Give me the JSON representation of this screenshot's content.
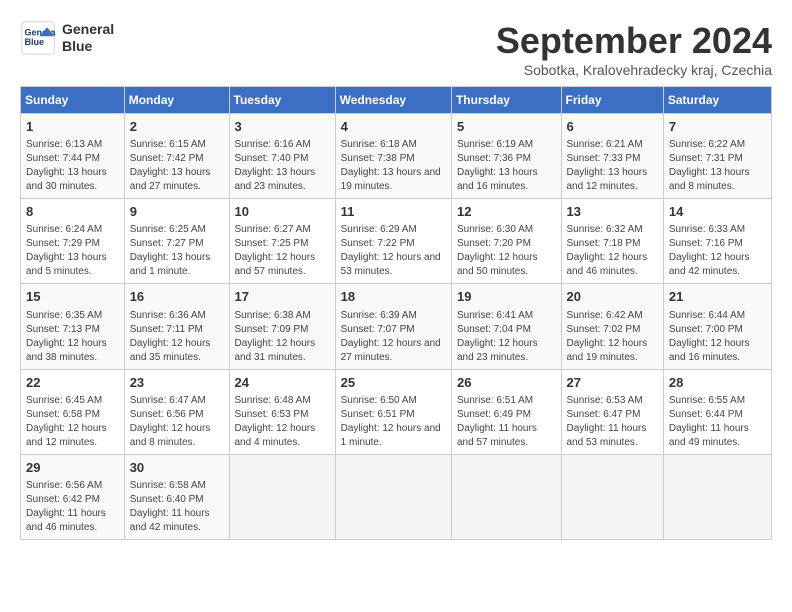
{
  "logo": {
    "line1": "General",
    "line2": "Blue"
  },
  "title": "September 2024",
  "subtitle": "Sobotka, Kralovehradecky kraj, Czechia",
  "days_of_week": [
    "Sunday",
    "Monday",
    "Tuesday",
    "Wednesday",
    "Thursday",
    "Friday",
    "Saturday"
  ],
  "weeks": [
    [
      {
        "day": "1",
        "sunrise": "6:13 AM",
        "sunset": "7:44 PM",
        "daylight": "13 hours and 30 minutes."
      },
      {
        "day": "2",
        "sunrise": "6:15 AM",
        "sunset": "7:42 PM",
        "daylight": "13 hours and 27 minutes."
      },
      {
        "day": "3",
        "sunrise": "6:16 AM",
        "sunset": "7:40 PM",
        "daylight": "13 hours and 23 minutes."
      },
      {
        "day": "4",
        "sunrise": "6:18 AM",
        "sunset": "7:38 PM",
        "daylight": "13 hours and 19 minutes."
      },
      {
        "day": "5",
        "sunrise": "6:19 AM",
        "sunset": "7:36 PM",
        "daylight": "13 hours and 16 minutes."
      },
      {
        "day": "6",
        "sunrise": "6:21 AM",
        "sunset": "7:33 PM",
        "daylight": "13 hours and 12 minutes."
      },
      {
        "day": "7",
        "sunrise": "6:22 AM",
        "sunset": "7:31 PM",
        "daylight": "13 hours and 8 minutes."
      }
    ],
    [
      {
        "day": "8",
        "sunrise": "6:24 AM",
        "sunset": "7:29 PM",
        "daylight": "13 hours and 5 minutes."
      },
      {
        "day": "9",
        "sunrise": "6:25 AM",
        "sunset": "7:27 PM",
        "daylight": "13 hours and 1 minute."
      },
      {
        "day": "10",
        "sunrise": "6:27 AM",
        "sunset": "7:25 PM",
        "daylight": "12 hours and 57 minutes."
      },
      {
        "day": "11",
        "sunrise": "6:29 AM",
        "sunset": "7:22 PM",
        "daylight": "12 hours and 53 minutes."
      },
      {
        "day": "12",
        "sunrise": "6:30 AM",
        "sunset": "7:20 PM",
        "daylight": "12 hours and 50 minutes."
      },
      {
        "day": "13",
        "sunrise": "6:32 AM",
        "sunset": "7:18 PM",
        "daylight": "12 hours and 46 minutes."
      },
      {
        "day": "14",
        "sunrise": "6:33 AM",
        "sunset": "7:16 PM",
        "daylight": "12 hours and 42 minutes."
      }
    ],
    [
      {
        "day": "15",
        "sunrise": "6:35 AM",
        "sunset": "7:13 PM",
        "daylight": "12 hours and 38 minutes."
      },
      {
        "day": "16",
        "sunrise": "6:36 AM",
        "sunset": "7:11 PM",
        "daylight": "12 hours and 35 minutes."
      },
      {
        "day": "17",
        "sunrise": "6:38 AM",
        "sunset": "7:09 PM",
        "daylight": "12 hours and 31 minutes."
      },
      {
        "day": "18",
        "sunrise": "6:39 AM",
        "sunset": "7:07 PM",
        "daylight": "12 hours and 27 minutes."
      },
      {
        "day": "19",
        "sunrise": "6:41 AM",
        "sunset": "7:04 PM",
        "daylight": "12 hours and 23 minutes."
      },
      {
        "day": "20",
        "sunrise": "6:42 AM",
        "sunset": "7:02 PM",
        "daylight": "12 hours and 19 minutes."
      },
      {
        "day": "21",
        "sunrise": "6:44 AM",
        "sunset": "7:00 PM",
        "daylight": "12 hours and 16 minutes."
      }
    ],
    [
      {
        "day": "22",
        "sunrise": "6:45 AM",
        "sunset": "6:58 PM",
        "daylight": "12 hours and 12 minutes."
      },
      {
        "day": "23",
        "sunrise": "6:47 AM",
        "sunset": "6:56 PM",
        "daylight": "12 hours and 8 minutes."
      },
      {
        "day": "24",
        "sunrise": "6:48 AM",
        "sunset": "6:53 PM",
        "daylight": "12 hours and 4 minutes."
      },
      {
        "day": "25",
        "sunrise": "6:50 AM",
        "sunset": "6:51 PM",
        "daylight": "12 hours and 1 minute."
      },
      {
        "day": "26",
        "sunrise": "6:51 AM",
        "sunset": "6:49 PM",
        "daylight": "11 hours and 57 minutes."
      },
      {
        "day": "27",
        "sunrise": "6:53 AM",
        "sunset": "6:47 PM",
        "daylight": "11 hours and 53 minutes."
      },
      {
        "day": "28",
        "sunrise": "6:55 AM",
        "sunset": "6:44 PM",
        "daylight": "11 hours and 49 minutes."
      }
    ],
    [
      {
        "day": "29",
        "sunrise": "6:56 AM",
        "sunset": "6:42 PM",
        "daylight": "11 hours and 46 minutes."
      },
      {
        "day": "30",
        "sunrise": "6:58 AM",
        "sunset": "6:40 PM",
        "daylight": "11 hours and 42 minutes."
      },
      null,
      null,
      null,
      null,
      null
    ]
  ]
}
